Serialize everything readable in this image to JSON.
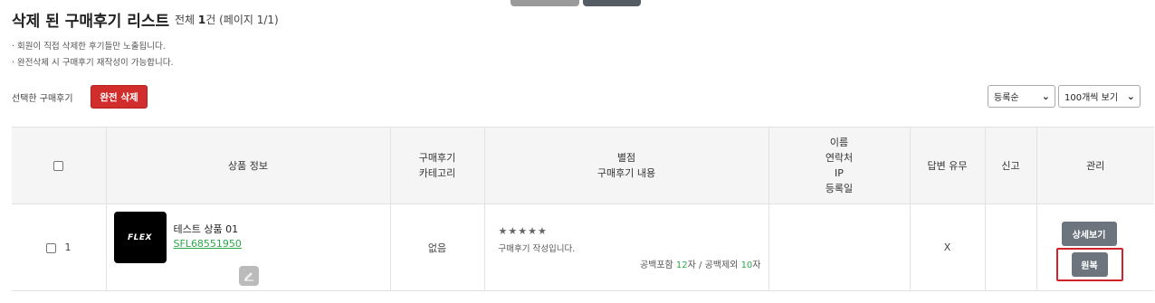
{
  "page": {
    "title": "삭제 된 구매후기 리스트",
    "count_prefix": "전체 ",
    "count_value": "1",
    "count_suffix": "건 (페이지 1/1)",
    "notes": [
      "· 회원이 직접 삭제한 후기들만 노출됩니다.",
      "· 완전삭제 시 구매후기 재작성이 가능합니다."
    ]
  },
  "toolbar": {
    "selected_label": "선택한 구매후기",
    "delete_button": "완전 삭제",
    "sort_select": "등록순",
    "per_page_select": "100개씩 보기"
  },
  "table": {
    "headers": {
      "product": "상품 정보",
      "category_line1": "구매후기",
      "category_line2": "카테고리",
      "rating_line1": "별점",
      "rating_line2": "구매후기 내용",
      "contact_line1": "이름",
      "contact_line2": "연락처",
      "contact_line3": "IP",
      "contact_line4": "등록일",
      "answered": "답변 유무",
      "reported": "신고",
      "manage": "관리"
    },
    "rows": [
      {
        "number": "1",
        "thumb_logo": "FLEX",
        "product_name": "테스트 상품 01",
        "product_code": "SFL68551950",
        "category": "없음",
        "stars": "★★★★★",
        "review_text": "구매후기 작성입니다.",
        "count_with_space_label": "공백포함 ",
        "count_with_space": "12",
        "count_mid": "자 / 공백제외 ",
        "count_without_space": "10",
        "count_end": "자",
        "answered": "X",
        "detail_button": "상세보기",
        "restore_button": "원복"
      }
    ]
  },
  "colors": {
    "delete_button": "#d22d2d",
    "code_link": "#2ca84a",
    "highlight_border": "#d2222a",
    "manage_button": "#6c757d"
  },
  "icons": {
    "edit": "pencil-icon",
    "select_chevron": "chevron-down-icon"
  }
}
